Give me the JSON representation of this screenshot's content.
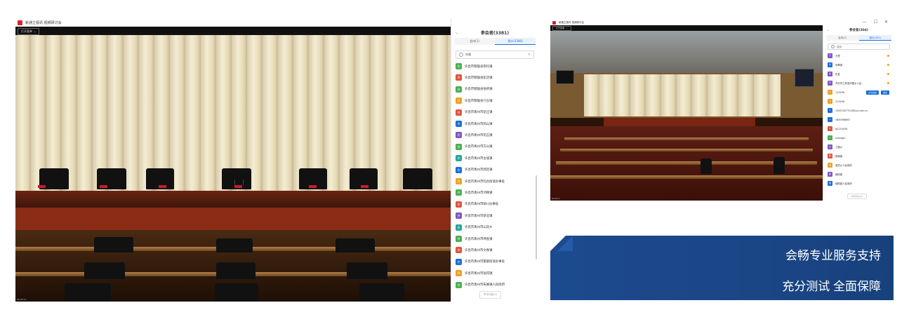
{
  "window1": {
    "title": "新通立视讯 视频研讨会",
    "controls": [
      "—",
      "⧉",
      "✕"
    ],
    "fullscreen_label": "打开菜单",
    "video_footer": "00:05:14",
    "panel": {
      "title": "参会者(3381)",
      "tabs": [
        "会内(1)",
        "观众(3380)"
      ],
      "search_value": "许昌",
      "participants": [
        {
          "name": "许昌市鄢陵县南坞镇",
          "color": "#4caf50",
          "badge": "许"
        },
        {
          "name": "许昌市鄢陵县彭店镇",
          "color": "#e0533c",
          "badge": "许"
        },
        {
          "name": "许昌市鄢陵县张桥镇",
          "color": "#4caf50",
          "badge": "许"
        },
        {
          "name": "许昌市鄢陵县只乐镇",
          "color": "#f0a020",
          "badge": "许"
        },
        {
          "name": "许昌市禹州市苌庄镇",
          "color": "#e0533c",
          "badge": "许"
        },
        {
          "name": "许昌市禹州市鸠山镇",
          "color": "#1b6ed6",
          "badge": "许"
        },
        {
          "name": "许昌市禹州市花石镇",
          "color": "#7e57c2",
          "badge": "许"
        },
        {
          "name": "许昌市禹州市方山镇",
          "color": "#4caf50",
          "badge": "许"
        },
        {
          "name": "许昌市禹州市古城镇",
          "color": "#26a69a",
          "badge": "许"
        },
        {
          "name": "许昌市禹州市郭连镇",
          "color": "#1b6ed6",
          "badge": "许"
        },
        {
          "name": "许昌市禹州市钧台街道办事处",
          "color": "#f0a020",
          "badge": "许"
        },
        {
          "name": "许昌市禹州市鸿畅镇",
          "color": "#4caf50",
          "badge": "许"
        },
        {
          "name": "许昌市禹州市颍川办事处",
          "color": "#e0533c",
          "badge": "许"
        },
        {
          "name": "许昌市禹州市梁北镇",
          "color": "#7e57c2",
          "badge": "许"
        },
        {
          "name": "许昌市禹州市山货乡",
          "color": "#26a69a",
          "badge": "许"
        },
        {
          "name": "许昌市禹州市神垕镇",
          "color": "#4caf50",
          "badge": "许"
        },
        {
          "name": "许昌市禹州市文殊镇",
          "color": "#e0533c",
          "badge": "许"
        },
        {
          "name": "许昌市禹州市夏都街道办事处",
          "color": "#1b6ed6",
          "badge": "许"
        },
        {
          "name": "许昌市禹州市张得镇",
          "color": "#f0a020",
          "badge": "许"
        },
        {
          "name": "许昌市禹州市朱阁镇人民政府",
          "color": "#4caf50",
          "badge": "许"
        }
      ],
      "bottom_button": "举手列表(0)"
    }
  },
  "window2": {
    "title": "新通立视讯 视频研讨会",
    "controls": [
      "—",
      "☐",
      "✕"
    ],
    "fullscreen_label": "打开菜单",
    "video_footer": "00:05:14",
    "panel": {
      "title": "参会者(304)",
      "tabs": [
        "会内(1)",
        "观众(303)"
      ],
      "search_placeholder": "搜索",
      "participants": [
        {
          "name": "万里",
          "color": "#7e57c2",
          "badge": "万"
        },
        {
          "name": "何翠静",
          "color": "#1b6ed6",
          "badge": "何"
        },
        {
          "name": "杞县",
          "color": "#7e57c2",
          "badge": "杞"
        },
        {
          "name": "开封市兰考县闫楼乡人民...",
          "color": "#7e57c2",
          "badge": "开"
        },
        {
          "name": "123456",
          "color": "#f0a020",
          "badge": "1"
        },
        {
          "name": "123456",
          "color": "#f0a020",
          "badge": "1"
        },
        {
          "name": "15637407702@xxx.com.cn",
          "color": "#1b6ed6",
          "badge": "1"
        },
        {
          "name": "1660988667",
          "color": "#1b6ed6",
          "badge": "1"
        },
        {
          "name": "bjl123456",
          "color": "#e0533c",
          "badge": "b"
        },
        {
          "name": "zhengjie",
          "color": "#4caf50",
          "badge": "z"
        },
        {
          "name": "兰楼乡",
          "color": "#7e57c2",
          "badge": "兰"
        },
        {
          "name": "阳堌镇",
          "color": "#e0533c",
          "badge": "阳"
        },
        {
          "name": "城关乡人民政府",
          "color": "#f0a020",
          "badge": "城"
        },
        {
          "name": "固阳镇",
          "color": "#7e57c2",
          "badge": "固"
        },
        {
          "name": "堌阳镇人民政府",
          "color": "#1b6ed6",
          "badge": "堌"
        }
      ],
      "row_buttons": [
        "允许发言",
        "更多"
      ],
      "bottom_button": "举手列表(0)"
    }
  },
  "banner": {
    "line1": "会畅专业服务支持",
    "line2": "充分测试 全面保障"
  }
}
